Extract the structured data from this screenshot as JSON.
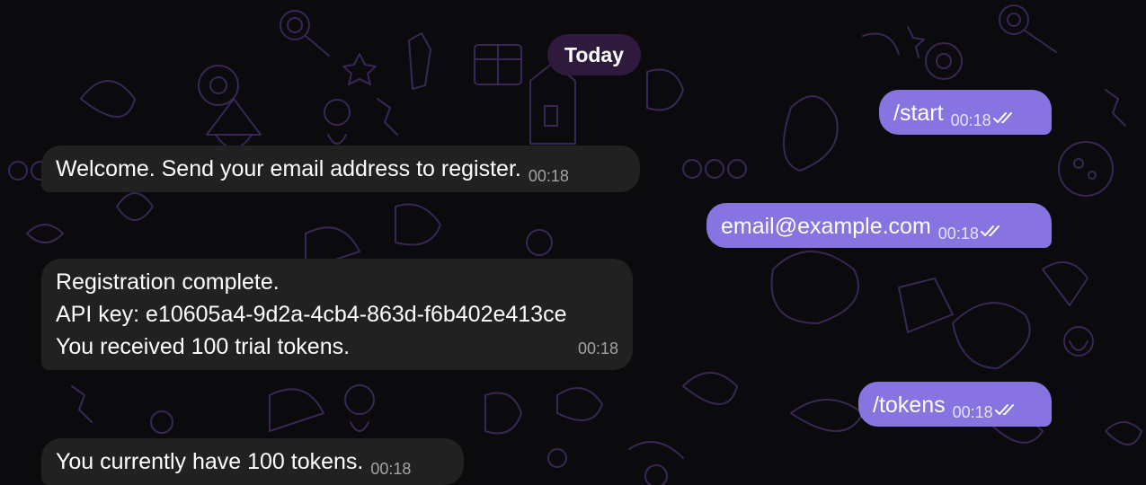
{
  "date_separator": "Today",
  "messages": [
    {
      "side": "out",
      "text": "/start",
      "time": "00:18",
      "status": "read"
    },
    {
      "side": "in",
      "text": "Welcome. Send your email address to register.",
      "time": "00:18"
    },
    {
      "side": "out",
      "text": "email@example.com",
      "time": "00:18",
      "status": "read"
    },
    {
      "side": "in",
      "lines": [
        "Registration complete.",
        "API key: e10605a4-9d2a-4cb4-863d-f6b402e413ce",
        "You received 100 trial tokens."
      ],
      "time": "00:18"
    },
    {
      "side": "out",
      "text": "/tokens",
      "time": "00:18",
      "status": "read"
    },
    {
      "side": "in",
      "text": "You currently have 100 tokens.",
      "time": "00:18"
    }
  ],
  "colors": {
    "background": "#0b0a0d",
    "incoming_bubble": "#212121",
    "outgoing_bubble": "#8774e1",
    "date_pill": "#2f1a3e",
    "doodle": "#3e2a5c"
  },
  "icons": [
    "double-check-icon"
  ]
}
